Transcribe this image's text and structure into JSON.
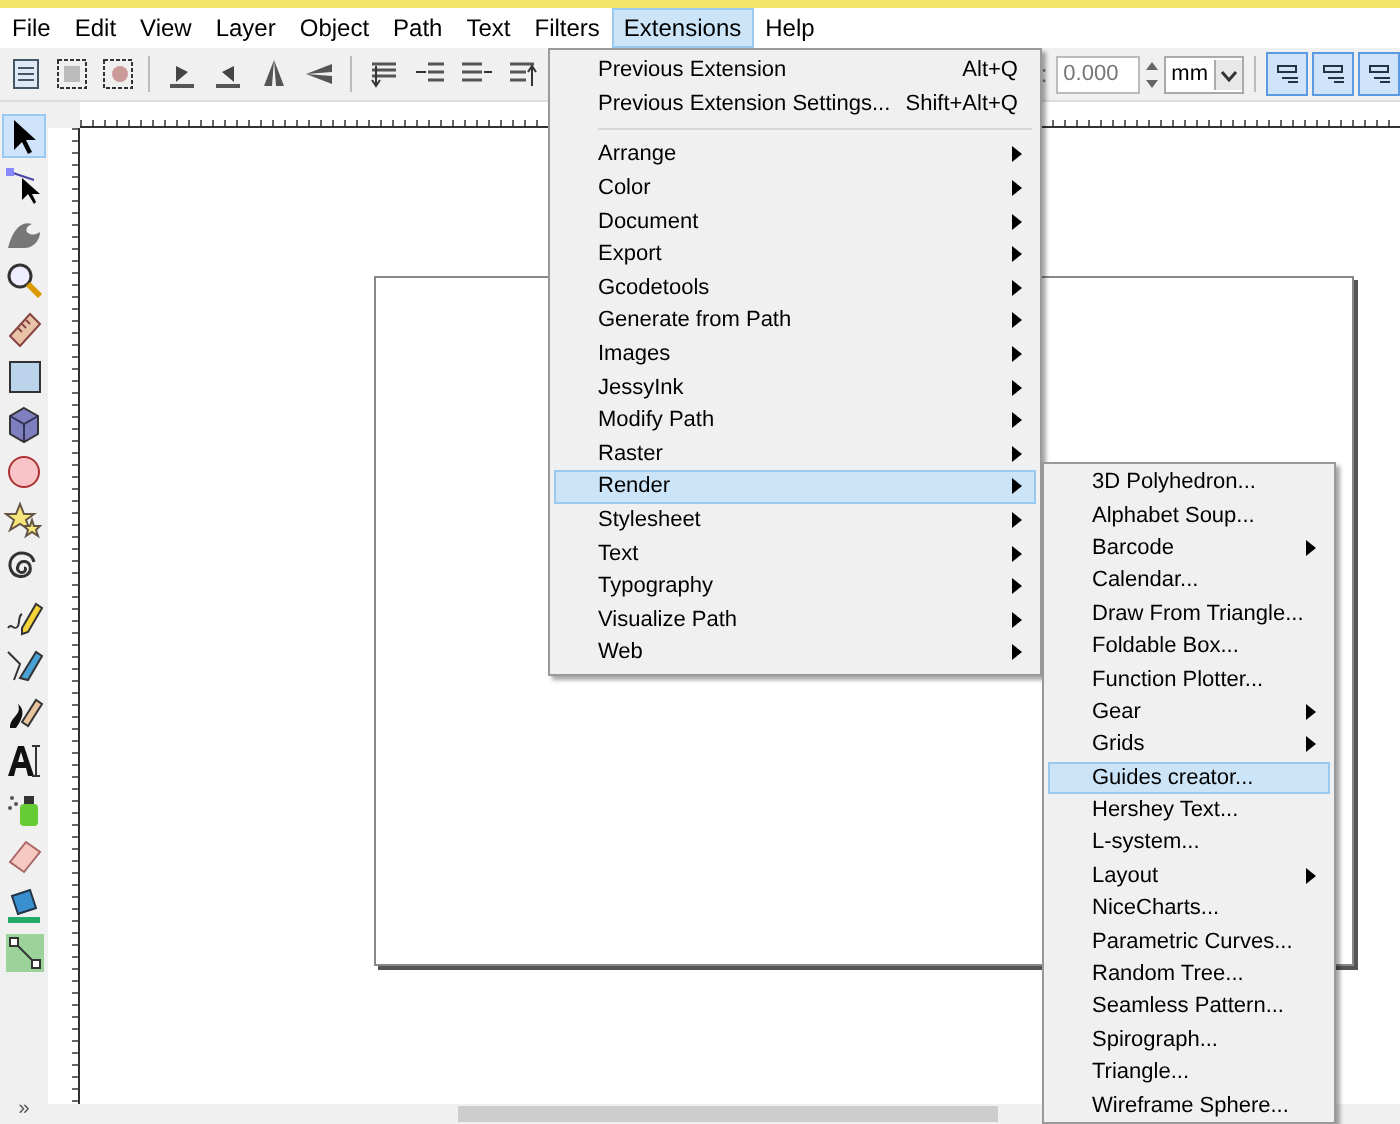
{
  "menubar": [
    {
      "label": "File",
      "selected": false
    },
    {
      "label": "Edit",
      "selected": false
    },
    {
      "label": "View",
      "selected": false
    },
    {
      "label": "Layer",
      "selected": false
    },
    {
      "label": "Object",
      "selected": false
    },
    {
      "label": "Path",
      "selected": false
    },
    {
      "label": "Text",
      "selected": false
    },
    {
      "label": "Filters",
      "selected": false
    },
    {
      "label": "Extensions",
      "selected": true
    },
    {
      "label": "Help",
      "selected": false
    }
  ],
  "toolbar": {
    "field_label": ":",
    "value": "0.000",
    "unit": "mm",
    "toggles": [
      {
        "selected": true
      },
      {
        "selected": true
      },
      {
        "selected": true
      }
    ]
  },
  "toolbox": {
    "tools": [
      {
        "selected": true
      },
      {
        "selected": false
      },
      {
        "selected": false
      },
      {
        "selected": false
      },
      {
        "selected": false
      },
      {
        "selected": false
      },
      {
        "selected": false
      },
      {
        "selected": false
      },
      {
        "selected": false
      },
      {
        "selected": false
      },
      {
        "selected": false
      },
      {
        "selected": false
      },
      {
        "selected": false
      },
      {
        "selected": false
      },
      {
        "selected": false
      },
      {
        "selected": false
      },
      {
        "selected": false
      },
      {
        "selected": false
      }
    ],
    "overflow": "»"
  },
  "extensions_menu": {
    "items": [
      {
        "kind": "item",
        "label": "Previous Extension",
        "shortcut": "Alt+Q",
        "submenu": false,
        "selected": false
      },
      {
        "kind": "item",
        "label": "Previous Extension Settings...",
        "shortcut": "Shift+Alt+Q",
        "submenu": false,
        "selected": false
      },
      {
        "kind": "separator"
      },
      {
        "kind": "item",
        "label": "Arrange",
        "submenu": true,
        "selected": false
      },
      {
        "kind": "item",
        "label": "Color",
        "submenu": true,
        "selected": false
      },
      {
        "kind": "item",
        "label": "Document",
        "submenu": true,
        "selected": false
      },
      {
        "kind": "item",
        "label": "Export",
        "submenu": true,
        "selected": false
      },
      {
        "kind": "item",
        "label": "Gcodetools",
        "submenu": true,
        "selected": false
      },
      {
        "kind": "item",
        "label": "Generate from Path",
        "submenu": true,
        "selected": false
      },
      {
        "kind": "item",
        "label": "Images",
        "submenu": true,
        "selected": false
      },
      {
        "kind": "item",
        "label": "JessyInk",
        "submenu": true,
        "selected": false
      },
      {
        "kind": "item",
        "label": "Modify Path",
        "submenu": true,
        "selected": false
      },
      {
        "kind": "item",
        "label": "Raster",
        "submenu": true,
        "selected": false
      },
      {
        "kind": "item",
        "label": "Render",
        "submenu": true,
        "selected": true
      },
      {
        "kind": "item",
        "label": "Stylesheet",
        "submenu": true,
        "selected": false
      },
      {
        "kind": "item",
        "label": "Text",
        "submenu": true,
        "selected": false
      },
      {
        "kind": "item",
        "label": "Typography",
        "submenu": true,
        "selected": false
      },
      {
        "kind": "item",
        "label": "Visualize Path",
        "submenu": true,
        "selected": false
      },
      {
        "kind": "item",
        "label": "Web",
        "submenu": true,
        "selected": false
      }
    ]
  },
  "render_submenu": {
    "items": [
      {
        "label": "3D Polyhedron...",
        "submenu": false,
        "selected": false
      },
      {
        "label": "Alphabet Soup...",
        "submenu": false,
        "selected": false
      },
      {
        "label": "Barcode",
        "submenu": true,
        "selected": false
      },
      {
        "label": "Calendar...",
        "submenu": false,
        "selected": false
      },
      {
        "label": "Draw From Triangle...",
        "submenu": false,
        "selected": false
      },
      {
        "label": "Foldable Box...",
        "submenu": false,
        "selected": false
      },
      {
        "label": "Function Plotter...",
        "submenu": false,
        "selected": false
      },
      {
        "label": "Gear",
        "submenu": true,
        "selected": false
      },
      {
        "label": "Grids",
        "submenu": true,
        "selected": false
      },
      {
        "label": "Guides creator...",
        "submenu": false,
        "selected": true
      },
      {
        "label": "Hershey Text...",
        "submenu": false,
        "selected": false
      },
      {
        "label": "L-system...",
        "submenu": false,
        "selected": false
      },
      {
        "label": "Layout",
        "submenu": true,
        "selected": false
      },
      {
        "label": "NiceCharts...",
        "submenu": false,
        "selected": false
      },
      {
        "label": "Parametric Curves...",
        "submenu": false,
        "selected": false
      },
      {
        "label": "Random Tree...",
        "submenu": false,
        "selected": false
      },
      {
        "label": "Seamless Pattern...",
        "submenu": false,
        "selected": false
      },
      {
        "label": "Spirograph...",
        "submenu": false,
        "selected": false
      },
      {
        "label": "Triangle...",
        "submenu": false,
        "selected": false
      },
      {
        "label": "Wireframe Sphere...",
        "submenu": false,
        "selected": false
      }
    ]
  }
}
